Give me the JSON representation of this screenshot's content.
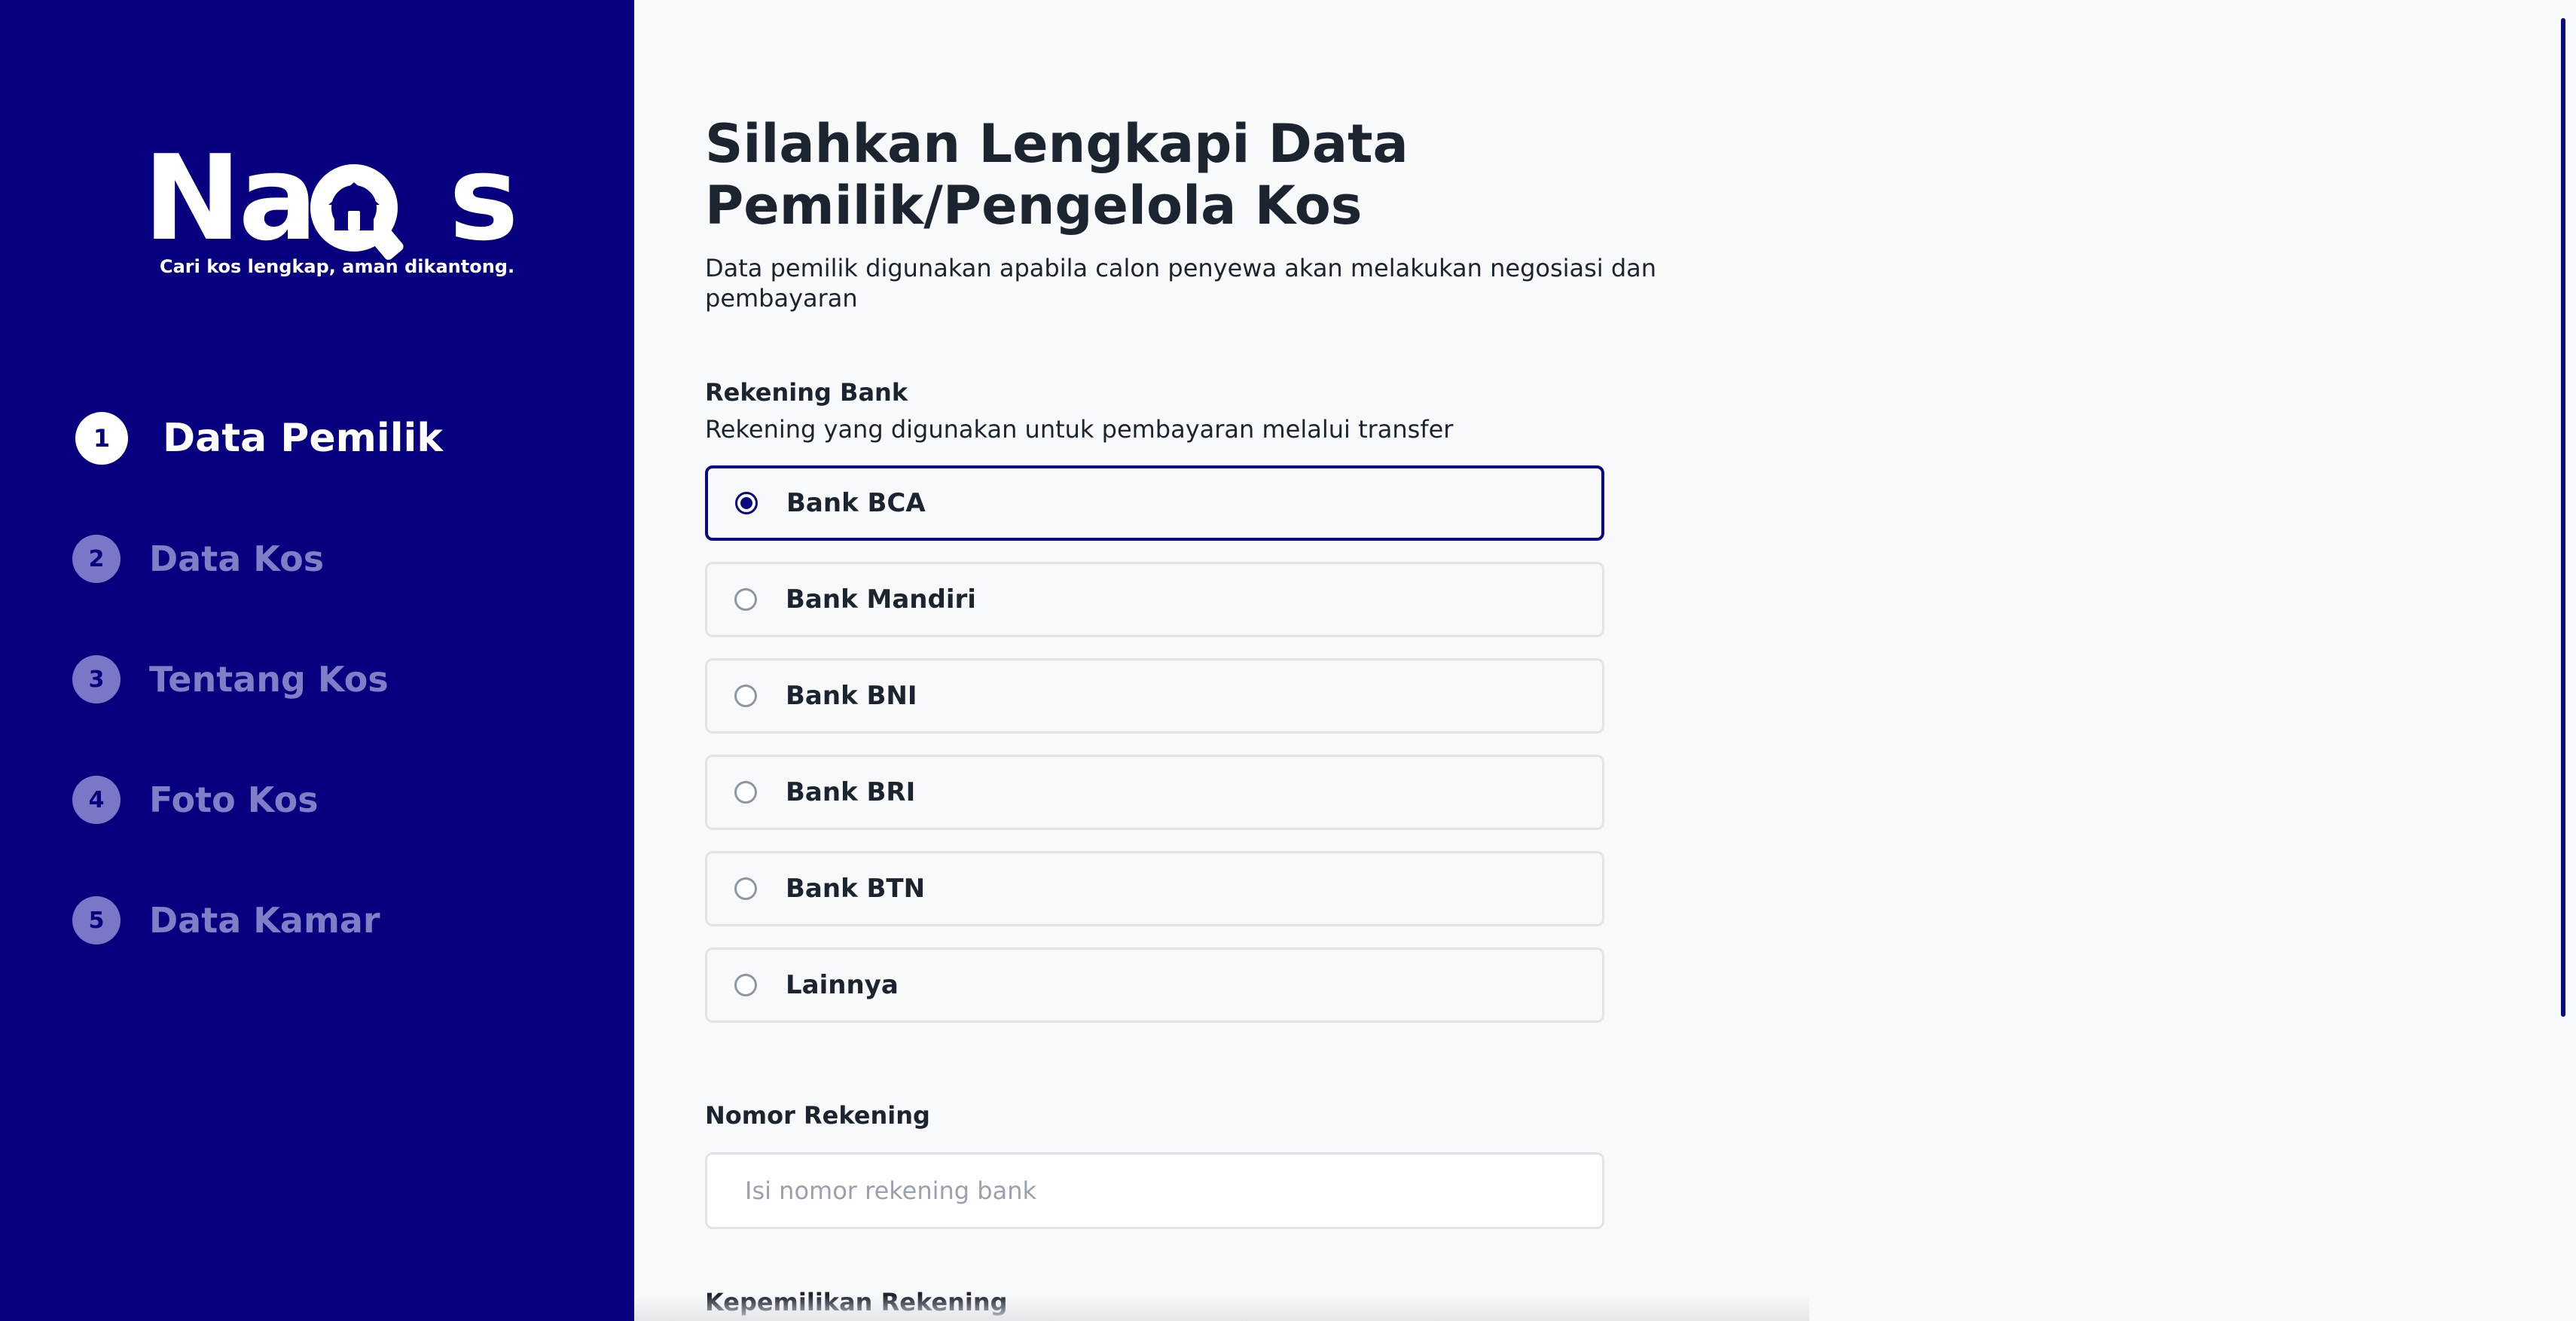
{
  "sidebar": {
    "logo": {
      "pre": "Na",
      "post": "s",
      "tagline": "Cari kos lengkap, aman dikantong."
    },
    "steps": [
      {
        "num": "1",
        "label": "Data Pemilik",
        "active": true
      },
      {
        "num": "2",
        "label": "Data Kos",
        "active": false
      },
      {
        "num": "3",
        "label": "Tentang Kos",
        "active": false
      },
      {
        "num": "4",
        "label": "Foto Kos",
        "active": false
      },
      {
        "num": "5",
        "label": "Data Kamar",
        "active": false
      }
    ]
  },
  "main": {
    "title": "Silahkan Lengkapi Data Pemilik/Pengelola Kos",
    "subtitle": "Data pemilik digunakan apabila calon penyewa akan melakukan negosiasi dan pembayaran",
    "bank": {
      "label": "Rekening Bank",
      "hint": "Rekening yang digunakan untuk pembayaran melalui transfer",
      "options": [
        "Bank BCA",
        "Bank Mandiri",
        "Bank BNI",
        "Bank BRI",
        "Bank BTN",
        "Lainnya"
      ],
      "selected": "Bank BCA"
    },
    "account_number": {
      "label": "Nomor Rekening",
      "placeholder": "Isi nomor rekening bank",
      "value": ""
    },
    "ownership": {
      "label": "Kepemilikan Rekening"
    }
  },
  "colors": {
    "sidebar_bg": "#07007f",
    "accent": "#0a0a80",
    "page_bg": "#f8f9fb"
  }
}
